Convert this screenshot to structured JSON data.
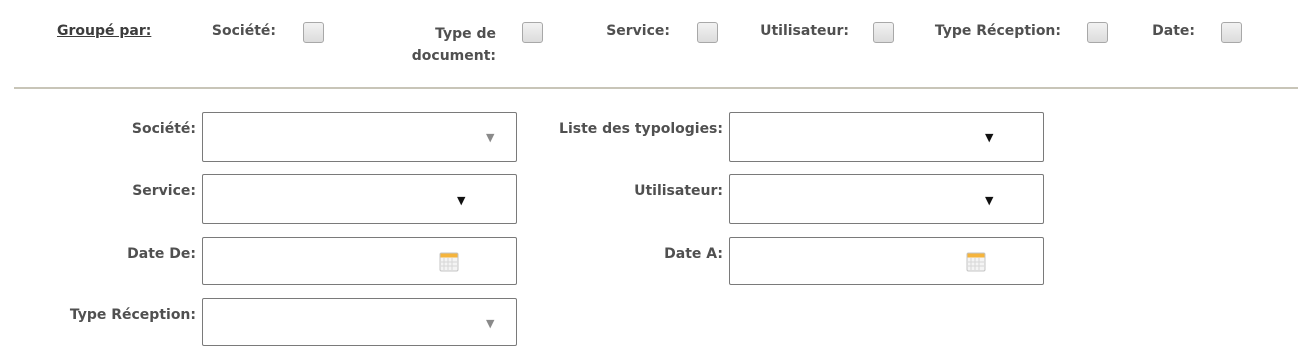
{
  "group_by": {
    "title": "Groupé par:",
    "options": [
      {
        "label": "Société:"
      },
      {
        "label_line1": "Type de",
        "label_line2": "document:"
      },
      {
        "label": "Service:"
      },
      {
        "label": "Utilisateur:"
      },
      {
        "label": "Type Réception:"
      },
      {
        "label": "Date:"
      }
    ]
  },
  "filters": {
    "societe": {
      "label": "Société:",
      "value": ""
    },
    "liste_typologies": {
      "label": "Liste des typologies:",
      "value": ""
    },
    "service": {
      "label": "Service:",
      "value": ""
    },
    "utilisateur": {
      "label": "Utilisateur:",
      "value": ""
    },
    "date_de": {
      "label": "Date De:",
      "value": ""
    },
    "date_a": {
      "label": "Date A:",
      "value": ""
    },
    "type_reception": {
      "label": "Type Réception:",
      "value": ""
    }
  },
  "icons": {
    "dropdown": "chevron-down-icon",
    "date": "calendar-icon"
  },
  "colors": {
    "separator": "#c8c5b8",
    "checkbox_fill": "#dcdcdc",
    "text": "#505050"
  }
}
